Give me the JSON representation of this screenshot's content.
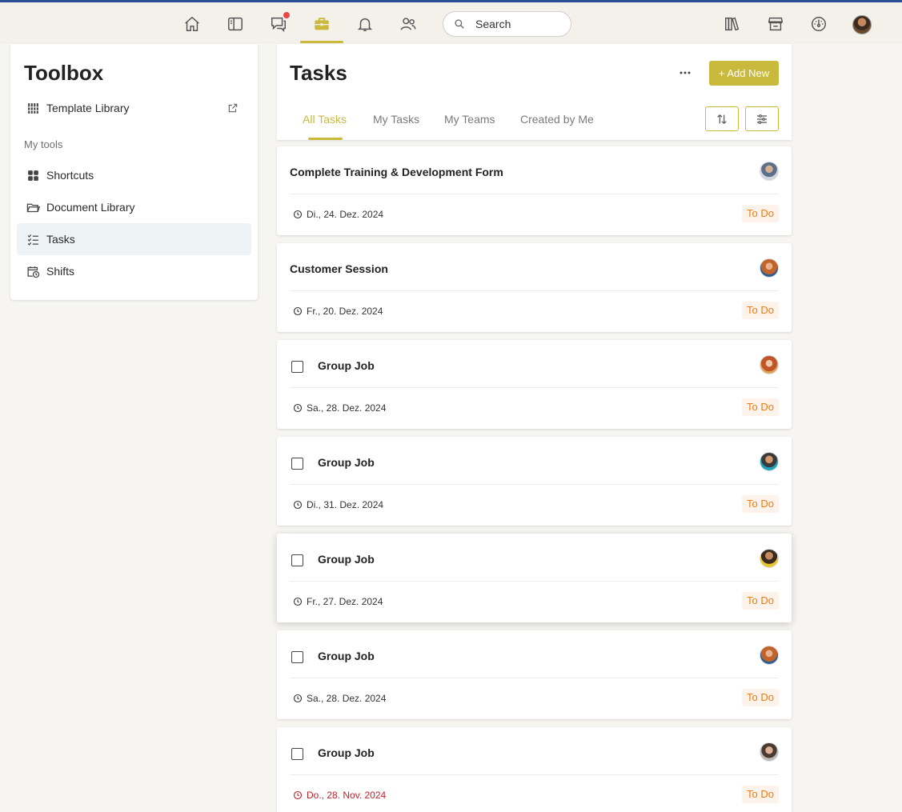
{
  "topnav": {
    "icons": [
      "home-icon",
      "sidebar-panel-icon",
      "chat-icon",
      "toolbox-icon",
      "bell-icon",
      "people-icon"
    ],
    "right_icons": [
      "library-icon",
      "store-icon",
      "dashboard-icon"
    ],
    "search_placeholder": "Search",
    "active": "toolbox-icon",
    "accent": "#c9b93d",
    "notification_color": "#e84545"
  },
  "sidebar": {
    "title": "Toolbox",
    "template_library": "Template Library",
    "section_label": "My tools",
    "items": [
      {
        "label": "Shortcuts",
        "icon": "shortcuts-icon"
      },
      {
        "label": "Document Library",
        "icon": "folder-icon"
      },
      {
        "label": "Tasks",
        "icon": "tasks-icon",
        "active": true
      },
      {
        "label": "Shifts",
        "icon": "calendar-clock-icon"
      }
    ]
  },
  "main": {
    "title": "Tasks",
    "add_label": "+ Add New",
    "tabs": [
      {
        "label": "All Tasks",
        "active": true
      },
      {
        "label": "My Tasks"
      },
      {
        "label": "My Teams"
      },
      {
        "label": "Created by Me"
      }
    ]
  },
  "tasks": [
    {
      "title": "Complete Training & Development Form",
      "date": "Di., 24. Dez. 2024",
      "status": "To Do",
      "checkbox": false,
      "overdue": false
    },
    {
      "title": "Customer Session",
      "date": "Fr., 20. Dez. 2024",
      "status": "To Do",
      "checkbox": false,
      "overdue": false
    },
    {
      "title": "Group Job",
      "date": "Sa., 28. Dez. 2024",
      "status": "To Do",
      "checkbox": true,
      "overdue": false
    },
    {
      "title": "Group Job",
      "date": "Di., 31. Dez. 2024",
      "status": "To Do",
      "checkbox": true,
      "overdue": false
    },
    {
      "title": "Group Job",
      "date": "Fr., 27. Dez. 2024",
      "status": "To Do",
      "checkbox": true,
      "overdue": false
    },
    {
      "title": "Group Job",
      "date": "Sa., 28. Dez. 2024",
      "status": "To Do",
      "checkbox": true,
      "overdue": false
    },
    {
      "title": "Group Job",
      "date": "Do., 28. Nov. 2024",
      "status": "To Do",
      "checkbox": true,
      "overdue": true
    }
  ]
}
